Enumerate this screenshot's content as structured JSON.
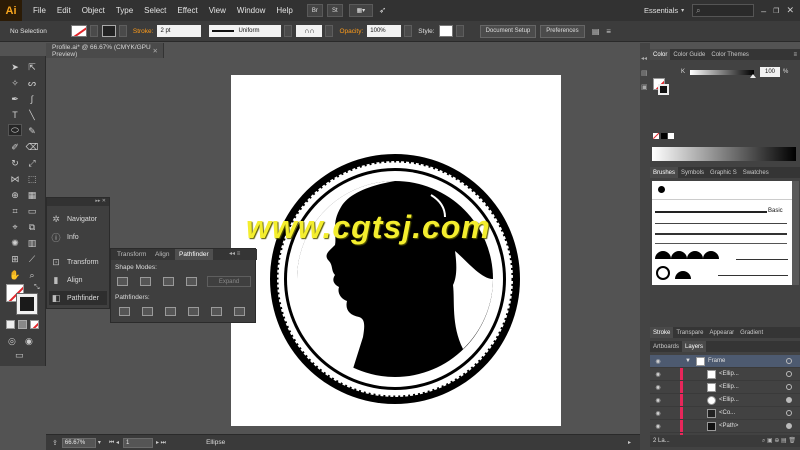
{
  "app": {
    "logo": "Ai",
    "workspace": "Essentials"
  },
  "menu": [
    "File",
    "Edit",
    "Object",
    "Type",
    "Select",
    "Effect",
    "View",
    "Window",
    "Help"
  ],
  "menubar_buttons": [
    "Br",
    "St"
  ],
  "controlbar": {
    "selection": "No Selection",
    "stroke_label": "Stroke:",
    "stroke_value": "2 pt",
    "profile": "Uniform",
    "opacity_label": "Opacity:",
    "opacity_value": "100%",
    "style_label": "Style:",
    "doc_setup": "Document Setup",
    "preferences": "Preferences"
  },
  "document": {
    "tab_title": "Profile.ai* @ 66.67% (CMYK/GPU Preview)"
  },
  "watermark": "www.cgtsj.com",
  "nav_panel": {
    "items": [
      "Navigator",
      "Info",
      "Transform",
      "Align",
      "Pathfinder"
    ]
  },
  "pathfinder_panel": {
    "tabs": [
      "Transform",
      "Align",
      "Pathfinder"
    ],
    "shape_modes": "Shape Modes:",
    "expand": "Expand",
    "pathfinders": "Pathfinders:"
  },
  "color_panel": {
    "tabs": [
      "Color",
      "Color Guide",
      "Color Themes"
    ],
    "k_label": "K",
    "k_value": "100",
    "percent": "%"
  },
  "brushes_panel": {
    "tabs": [
      "Brushes",
      "Symbols",
      "Graphic S",
      "Swatches"
    ],
    "basic_label": "Basic"
  },
  "stroke_panel": {
    "tabs": [
      "Stroke",
      "Transpare",
      "Appearar",
      "Gradient"
    ]
  },
  "layers_panel": {
    "tabs": [
      "Artboards",
      "Layers"
    ],
    "rows": [
      "Frame",
      "<Ellip...",
      "<Ellip...",
      "<Ellip...",
      "<Co...",
      "<Path>"
    ],
    "footer": "2 La..."
  },
  "statusbar": {
    "zoom": "66.67%",
    "artboard": "1",
    "tool": "Ellipse"
  },
  "colors": {
    "accent_orange": "#ff9c1a",
    "watermark_yellow": "#f4ee2e",
    "layer_red": "#e8265a"
  }
}
